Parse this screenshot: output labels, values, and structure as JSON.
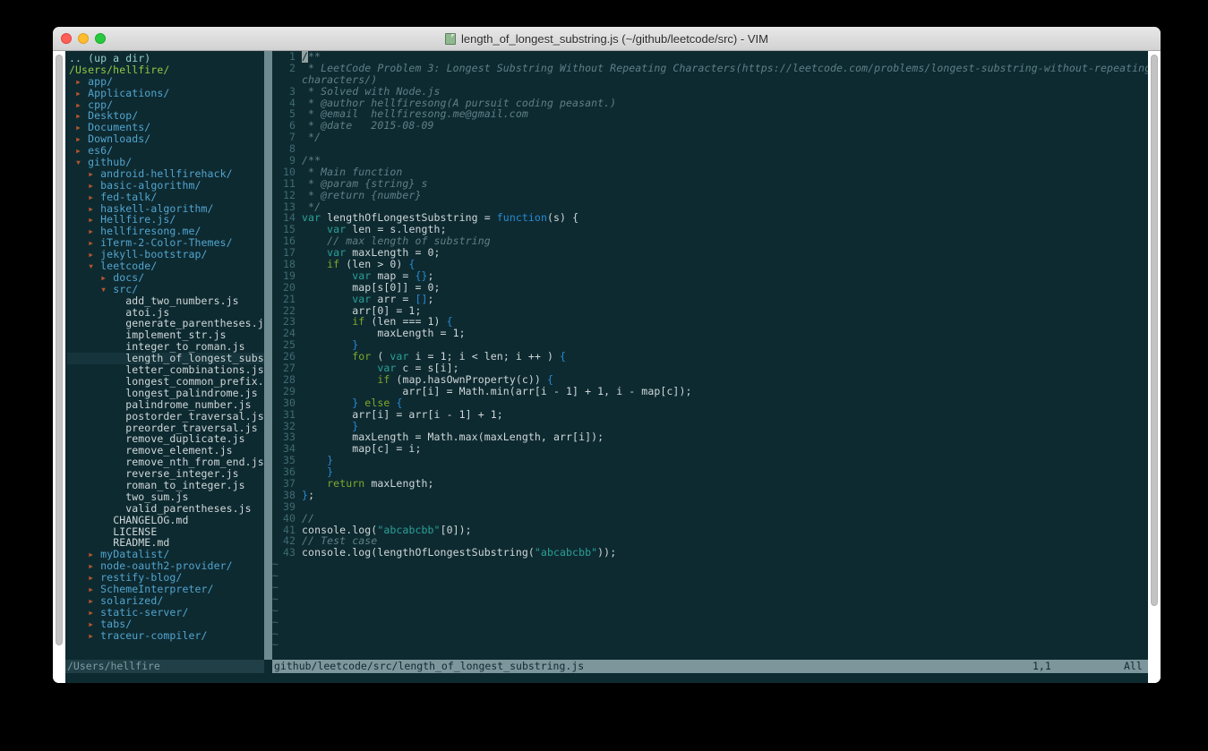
{
  "window": {
    "title": "length_of_longest_substring.js (~/github/leetcode/src) - VIM",
    "title_icon": "vim-file-icon",
    "traffic_lights": [
      "close-button",
      "minimize-button",
      "zoom-button"
    ]
  },
  "colors": {
    "terminal_bg": "#0e2a31",
    "directory": "#51a5cf",
    "file": "#cfd8d9",
    "root_path": "#8fc944",
    "arrow": "#b5562e",
    "comment": "#5f7f87",
    "keyword": "#2aa198",
    "control_keyword": "#7fa927",
    "function": "#268bd2",
    "string": "#2aa198",
    "line_number": "#3f6b72",
    "statusline_active_bg": "#7d969c",
    "statusline_inactive_bg": "#203f46",
    "split_divider": "#6f8b92",
    "selected_row_bg": "#16343b"
  },
  "tree": {
    "header_updir": ".. (up a dir)",
    "root": "/Users/hellfire/",
    "items": [
      {
        "indent": 0,
        "marker": "closed",
        "label": "app/",
        "kind": "dir"
      },
      {
        "indent": 0,
        "marker": "closed",
        "label": "Applications/",
        "kind": "dir"
      },
      {
        "indent": 0,
        "marker": "closed",
        "label": "cpp/",
        "kind": "dir"
      },
      {
        "indent": 0,
        "marker": "closed",
        "label": "Desktop/",
        "kind": "dir"
      },
      {
        "indent": 0,
        "marker": "closed",
        "label": "Documents/",
        "kind": "dir"
      },
      {
        "indent": 0,
        "marker": "closed",
        "label": "Downloads/",
        "kind": "dir"
      },
      {
        "indent": 0,
        "marker": "closed",
        "label": "es6/",
        "kind": "dir"
      },
      {
        "indent": 0,
        "marker": "open",
        "label": "github/",
        "kind": "dir"
      },
      {
        "indent": 1,
        "marker": "closed",
        "label": "android-hellfirehack/",
        "kind": "dir"
      },
      {
        "indent": 1,
        "marker": "closed",
        "label": "basic-algorithm/",
        "kind": "dir"
      },
      {
        "indent": 1,
        "marker": "closed",
        "label": "fed-talk/",
        "kind": "dir"
      },
      {
        "indent": 1,
        "marker": "closed",
        "label": "haskell-algorithm/",
        "kind": "dir"
      },
      {
        "indent": 1,
        "marker": "closed",
        "label": "Hellfire.js/",
        "kind": "dir"
      },
      {
        "indent": 1,
        "marker": "closed",
        "label": "hellfiresong.me/",
        "kind": "dir"
      },
      {
        "indent": 1,
        "marker": "closed",
        "label": "iTerm-2-Color-Themes/",
        "kind": "dir"
      },
      {
        "indent": 1,
        "marker": "closed",
        "label": "jekyll-bootstrap/",
        "kind": "dir"
      },
      {
        "indent": 1,
        "marker": "open",
        "label": "leetcode/",
        "kind": "dir"
      },
      {
        "indent": 2,
        "marker": "closed",
        "label": "docs/",
        "kind": "dir"
      },
      {
        "indent": 2,
        "marker": "open",
        "label": "src/",
        "kind": "dir"
      },
      {
        "indent": 3,
        "marker": "none",
        "label": "add_two_numbers.js",
        "kind": "file"
      },
      {
        "indent": 3,
        "marker": "none",
        "label": "atoi.js",
        "kind": "file"
      },
      {
        "indent": 3,
        "marker": "none",
        "label": "generate_parentheses.js",
        "kind": "file"
      },
      {
        "indent": 3,
        "marker": "none",
        "label": "implement_str.js",
        "kind": "file"
      },
      {
        "indent": 3,
        "marker": "none",
        "label": "integer_to_roman.js",
        "kind": "file"
      },
      {
        "indent": 3,
        "marker": "none",
        "label": "length_of_longest_subst",
        "kind": "file",
        "selected": true
      },
      {
        "indent": 3,
        "marker": "none",
        "label": "letter_combinations.js",
        "kind": "file"
      },
      {
        "indent": 3,
        "marker": "none",
        "label": "longest_common_prefix.j",
        "kind": "file"
      },
      {
        "indent": 3,
        "marker": "none",
        "label": "longest_palindrome.js",
        "kind": "file"
      },
      {
        "indent": 3,
        "marker": "none",
        "label": "palindrome_number.js",
        "kind": "file"
      },
      {
        "indent": 3,
        "marker": "none",
        "label": "postorder_traversal.js",
        "kind": "file"
      },
      {
        "indent": 3,
        "marker": "none",
        "label": "preorder_traversal.js",
        "kind": "file"
      },
      {
        "indent": 3,
        "marker": "none",
        "label": "remove_duplicate.js",
        "kind": "file"
      },
      {
        "indent": 3,
        "marker": "none",
        "label": "remove_element.js",
        "kind": "file"
      },
      {
        "indent": 3,
        "marker": "none",
        "label": "remove_nth_from_end.js",
        "kind": "file"
      },
      {
        "indent": 3,
        "marker": "none",
        "label": "reverse_integer.js",
        "kind": "file"
      },
      {
        "indent": 3,
        "marker": "none",
        "label": "roman_to_integer.js",
        "kind": "file"
      },
      {
        "indent": 3,
        "marker": "none",
        "label": "two_sum.js",
        "kind": "file"
      },
      {
        "indent": 3,
        "marker": "none",
        "label": "valid_parentheses.js",
        "kind": "file"
      },
      {
        "indent": 2,
        "marker": "none",
        "label": "CHANGELOG.md",
        "kind": "file"
      },
      {
        "indent": 2,
        "marker": "none",
        "label": "LICENSE",
        "kind": "file"
      },
      {
        "indent": 2,
        "marker": "none",
        "label": "README.md",
        "kind": "file"
      },
      {
        "indent": 1,
        "marker": "closed",
        "label": "myDatalist/",
        "kind": "dir"
      },
      {
        "indent": 1,
        "marker": "closed",
        "label": "node-oauth2-provider/",
        "kind": "dir"
      },
      {
        "indent": 1,
        "marker": "closed",
        "label": "restify-blog/",
        "kind": "dir"
      },
      {
        "indent": 1,
        "marker": "closed",
        "label": "SchemeInterpreter/",
        "kind": "dir"
      },
      {
        "indent": 1,
        "marker": "closed",
        "label": "solarized/",
        "kind": "dir"
      },
      {
        "indent": 1,
        "marker": "closed",
        "label": "static-server/",
        "kind": "dir"
      },
      {
        "indent": 1,
        "marker": "closed",
        "label": "tabs/",
        "kind": "dir"
      },
      {
        "indent": 1,
        "marker": "closed",
        "label": "traceur-compiler/",
        "kind": "dir"
      }
    ]
  },
  "code": {
    "lines": [
      {
        "n": "1",
        "tokens": [
          {
            "t": "/**",
            "c": "comment",
            "cursorAt": 0
          }
        ]
      },
      {
        "n": "2",
        "tokens": [
          {
            "t": " * LeetCode Problem 3: Longest Substring Without Repeating Characters(https://leetcode.com/problems/longest-substring-without-repeating-",
            "c": "comment"
          }
        ]
      },
      {
        "n": "",
        "wrap": true,
        "tokens": [
          {
            "t": "characters/)",
            "c": "comment"
          }
        ]
      },
      {
        "n": "3",
        "tokens": [
          {
            "t": " * Solved with Node.js",
            "c": "comment"
          }
        ]
      },
      {
        "n": "4",
        "tokens": [
          {
            "t": " * @author hellfiresong(A pursuit coding peasant.)",
            "c": "comment"
          }
        ]
      },
      {
        "n": "5",
        "tokens": [
          {
            "t": " * @email  hellfiresong.me@gmail.com",
            "c": "comment"
          }
        ]
      },
      {
        "n": "6",
        "tokens": [
          {
            "t": " * @date   2015-08-09",
            "c": "comment"
          }
        ]
      },
      {
        "n": "7",
        "tokens": [
          {
            "t": " */",
            "c": "comment"
          }
        ]
      },
      {
        "n": "8",
        "tokens": []
      },
      {
        "n": "9",
        "tokens": [
          {
            "t": "/**",
            "c": "comment"
          }
        ]
      },
      {
        "n": "10",
        "tokens": [
          {
            "t": " * Main function",
            "c": "comment"
          }
        ]
      },
      {
        "n": "11",
        "tokens": [
          {
            "t": " * @param {string} s",
            "c": "comment"
          }
        ]
      },
      {
        "n": "12",
        "tokens": [
          {
            "t": " * @return {number}",
            "c": "comment"
          }
        ]
      },
      {
        "n": "13",
        "tokens": [
          {
            "t": " */",
            "c": "comment"
          }
        ]
      },
      {
        "n": "14",
        "tokens": [
          {
            "t": "var",
            "c": "key"
          },
          {
            "t": " lengthOfLongestSubstring = ",
            "c": "plain"
          },
          {
            "t": "function",
            "c": "func"
          },
          {
            "t": "(s) {",
            "c": "plain"
          }
        ]
      },
      {
        "n": "15",
        "tokens": [
          {
            "t": "    ",
            "c": "plain"
          },
          {
            "t": "var",
            "c": "key"
          },
          {
            "t": " len = s.length;",
            "c": "plain"
          }
        ]
      },
      {
        "n": "16",
        "tokens": [
          {
            "t": "    // max length of substring",
            "c": "comment"
          }
        ]
      },
      {
        "n": "17",
        "tokens": [
          {
            "t": "    ",
            "c": "plain"
          },
          {
            "t": "var",
            "c": "key"
          },
          {
            "t": " maxLength = 0;",
            "c": "plain"
          }
        ]
      },
      {
        "n": "18",
        "tokens": [
          {
            "t": "    ",
            "c": "plain"
          },
          {
            "t": "if",
            "c": "key2"
          },
          {
            "t": " (len > 0) ",
            "c": "plain"
          },
          {
            "t": "{",
            "c": "punc"
          }
        ]
      },
      {
        "n": "19",
        "tokens": [
          {
            "t": "        ",
            "c": "plain"
          },
          {
            "t": "var",
            "c": "key"
          },
          {
            "t": " map = ",
            "c": "plain"
          },
          {
            "t": "{}",
            "c": "punc"
          },
          {
            "t": ";",
            "c": "plain"
          }
        ]
      },
      {
        "n": "20",
        "tokens": [
          {
            "t": "        map[s[0]] = 0;",
            "c": "plain"
          }
        ]
      },
      {
        "n": "21",
        "tokens": [
          {
            "t": "        ",
            "c": "plain"
          },
          {
            "t": "var",
            "c": "key"
          },
          {
            "t": " arr = ",
            "c": "plain"
          },
          {
            "t": "[]",
            "c": "punc"
          },
          {
            "t": ";",
            "c": "plain"
          }
        ]
      },
      {
        "n": "22",
        "tokens": [
          {
            "t": "        arr[0] = 1;",
            "c": "plain"
          }
        ]
      },
      {
        "n": "23",
        "tokens": [
          {
            "t": "        ",
            "c": "plain"
          },
          {
            "t": "if",
            "c": "key2"
          },
          {
            "t": " (len === 1) ",
            "c": "plain"
          },
          {
            "t": "{",
            "c": "punc"
          }
        ]
      },
      {
        "n": "24",
        "tokens": [
          {
            "t": "            maxLength = 1;",
            "c": "plain"
          }
        ]
      },
      {
        "n": "25",
        "tokens": [
          {
            "t": "        ",
            "c": "plain"
          },
          {
            "t": "}",
            "c": "punc"
          }
        ]
      },
      {
        "n": "26",
        "tokens": [
          {
            "t": "        ",
            "c": "plain"
          },
          {
            "t": "for",
            "c": "key2"
          },
          {
            "t": " ( ",
            "c": "plain"
          },
          {
            "t": "var",
            "c": "key"
          },
          {
            "t": " i = 1; i < len; i ++ ) ",
            "c": "plain"
          },
          {
            "t": "{",
            "c": "punc"
          }
        ]
      },
      {
        "n": "27",
        "tokens": [
          {
            "t": "            ",
            "c": "plain"
          },
          {
            "t": "var",
            "c": "key"
          },
          {
            "t": " c = s[i];",
            "c": "plain"
          }
        ]
      },
      {
        "n": "28",
        "tokens": [
          {
            "t": "            ",
            "c": "plain"
          },
          {
            "t": "if",
            "c": "key2"
          },
          {
            "t": " (map.hasOwnProperty(c)) ",
            "c": "plain"
          },
          {
            "t": "{",
            "c": "punc"
          }
        ]
      },
      {
        "n": "29",
        "tokens": [
          {
            "t": "                arr[i] = Math.min(arr[i - 1] + 1, i - map[c]);",
            "c": "plain"
          }
        ]
      },
      {
        "n": "30",
        "tokens": [
          {
            "t": "        ",
            "c": "plain"
          },
          {
            "t": "}",
            "c": "punc"
          },
          {
            "t": " ",
            "c": "plain"
          },
          {
            "t": "else",
            "c": "key2"
          },
          {
            "t": " ",
            "c": "plain"
          },
          {
            "t": "{",
            "c": "punc"
          }
        ]
      },
      {
        "n": "31",
        "tokens": [
          {
            "t": "        arr[i] = arr[i - 1] + 1;",
            "c": "plain"
          }
        ]
      },
      {
        "n": "32",
        "tokens": [
          {
            "t": "        ",
            "c": "plain"
          },
          {
            "t": "}",
            "c": "punc"
          }
        ]
      },
      {
        "n": "33",
        "tokens": [
          {
            "t": "        maxLength = Math.max(maxLength, arr[i]);",
            "c": "plain"
          }
        ]
      },
      {
        "n": "34",
        "tokens": [
          {
            "t": "        map[c] = i;",
            "c": "plain"
          }
        ]
      },
      {
        "n": "35",
        "tokens": [
          {
            "t": "    ",
            "c": "plain"
          },
          {
            "t": "}",
            "c": "punc"
          }
        ]
      },
      {
        "n": "36",
        "tokens": [
          {
            "t": "    ",
            "c": "plain"
          },
          {
            "t": "}",
            "c": "punc"
          }
        ]
      },
      {
        "n": "37",
        "tokens": [
          {
            "t": "    ",
            "c": "plain"
          },
          {
            "t": "return",
            "c": "key2"
          },
          {
            "t": " maxLength;",
            "c": "plain"
          }
        ]
      },
      {
        "n": "38",
        "tokens": [
          {
            "t": "}",
            "c": "punc"
          },
          {
            "t": ";",
            "c": "plain"
          }
        ]
      },
      {
        "n": "39",
        "tokens": []
      },
      {
        "n": "40",
        "tokens": [
          {
            "t": "//",
            "c": "comment"
          }
        ]
      },
      {
        "n": "41",
        "tokens": [
          {
            "t": "console.log(",
            "c": "plain"
          },
          {
            "t": "\"abcabcbb\"",
            "c": "str"
          },
          {
            "t": "[0]);",
            "c": "plain"
          }
        ]
      },
      {
        "n": "42",
        "tokens": [
          {
            "t": "// Test case",
            "c": "comment"
          }
        ]
      },
      {
        "n": "43",
        "tokens": [
          {
            "t": "console.log(lengthOfLongestSubstring(",
            "c": "plain"
          },
          {
            "t": "\"abcabcbb\"",
            "c": "str"
          },
          {
            "t": "));",
            "c": "plain"
          }
        ]
      }
    ],
    "empty_marker": "~",
    "empty_line_count": 8
  },
  "statusline": {
    "tree_pane": "/Users/hellfire",
    "file_pane": "github/leetcode/src/length_of_longest_substring.js",
    "position": "1,1",
    "scroll": "All"
  }
}
